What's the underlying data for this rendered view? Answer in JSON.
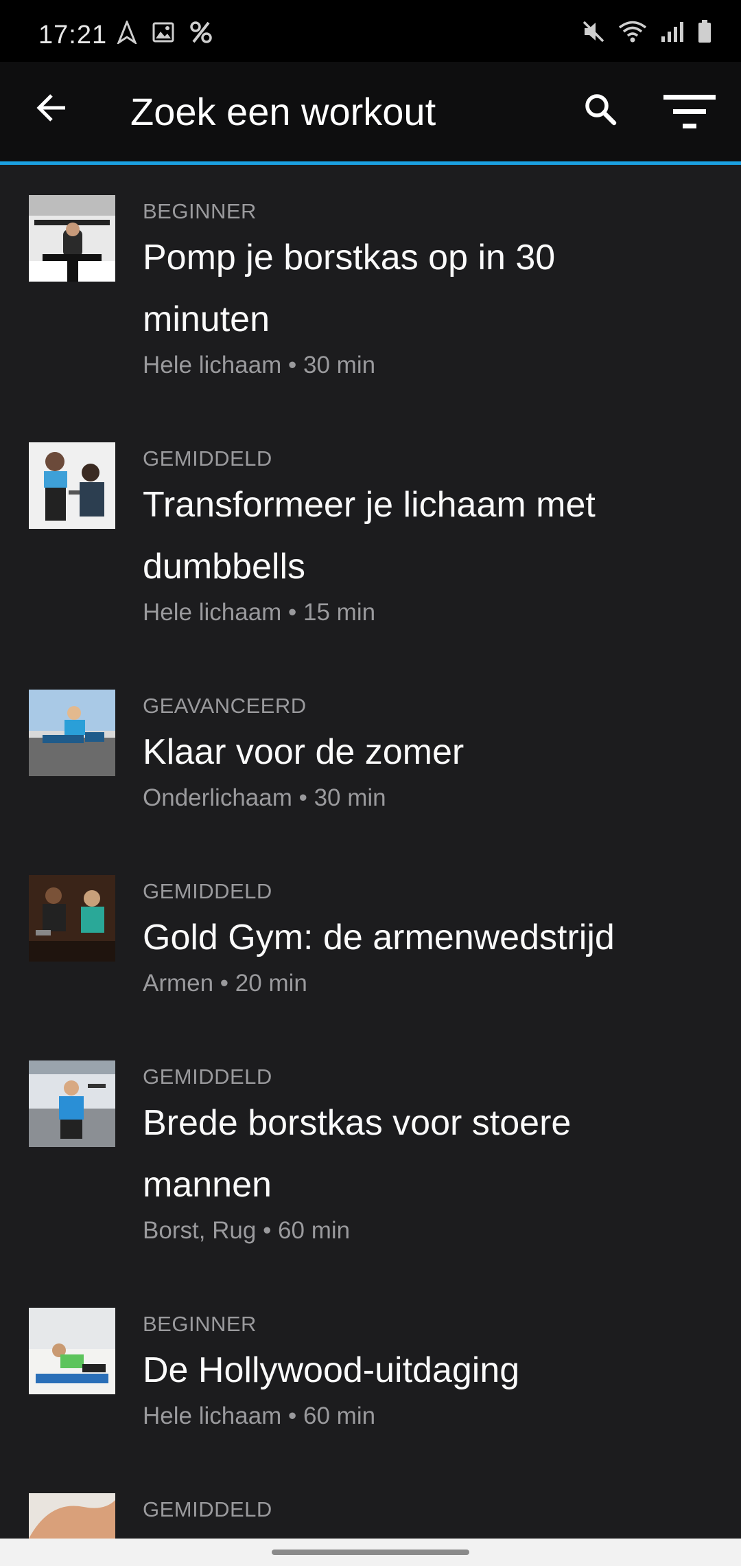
{
  "status_bar": {
    "time": "17:21",
    "left_icons": [
      "navigation-icon",
      "gallery-icon",
      "percent-icon"
    ],
    "right_icons": [
      "mute-icon",
      "wifi-icon",
      "signal-icon",
      "battery-icon"
    ]
  },
  "app_bar": {
    "title": "Zoek een workout",
    "back_icon": "arrow-left-icon",
    "search_icon": "search-icon",
    "filter_icon": "filter-icon",
    "accent_color": "#1ba1e2"
  },
  "workouts": [
    {
      "level": "BEGINNER",
      "title_line1": "Pomp je borstkas op in 30",
      "title_line2": "minuten",
      "meta": "Hele lichaam • 30 min"
    },
    {
      "level": "GEMIDDELD",
      "title_line1": "Transformeer je lichaam met",
      "title_line2": "dumbbells",
      "meta": "Hele lichaam • 15 min"
    },
    {
      "level": "GEAVANCEERD",
      "title_line1": "Klaar voor de zomer",
      "title_line2": "",
      "meta": "Onderlichaam • 30 min"
    },
    {
      "level": "GEMIDDELD",
      "title_line1": "Gold Gym: de armenwedstrijd",
      "title_line2": "",
      "meta": "Armen • 20 min"
    },
    {
      "level": "GEMIDDELD",
      "title_line1": "Brede borstkas voor stoere",
      "title_line2": "mannen",
      "meta": "Borst, Rug • 60 min"
    },
    {
      "level": "BEGINNER",
      "title_line1": "De Hollywood-uitdaging",
      "title_line2": "",
      "meta": "Hele lichaam • 60 min"
    },
    {
      "level": "GEMIDDELD",
      "title_line1": "",
      "title_line2": "",
      "meta": ""
    }
  ]
}
